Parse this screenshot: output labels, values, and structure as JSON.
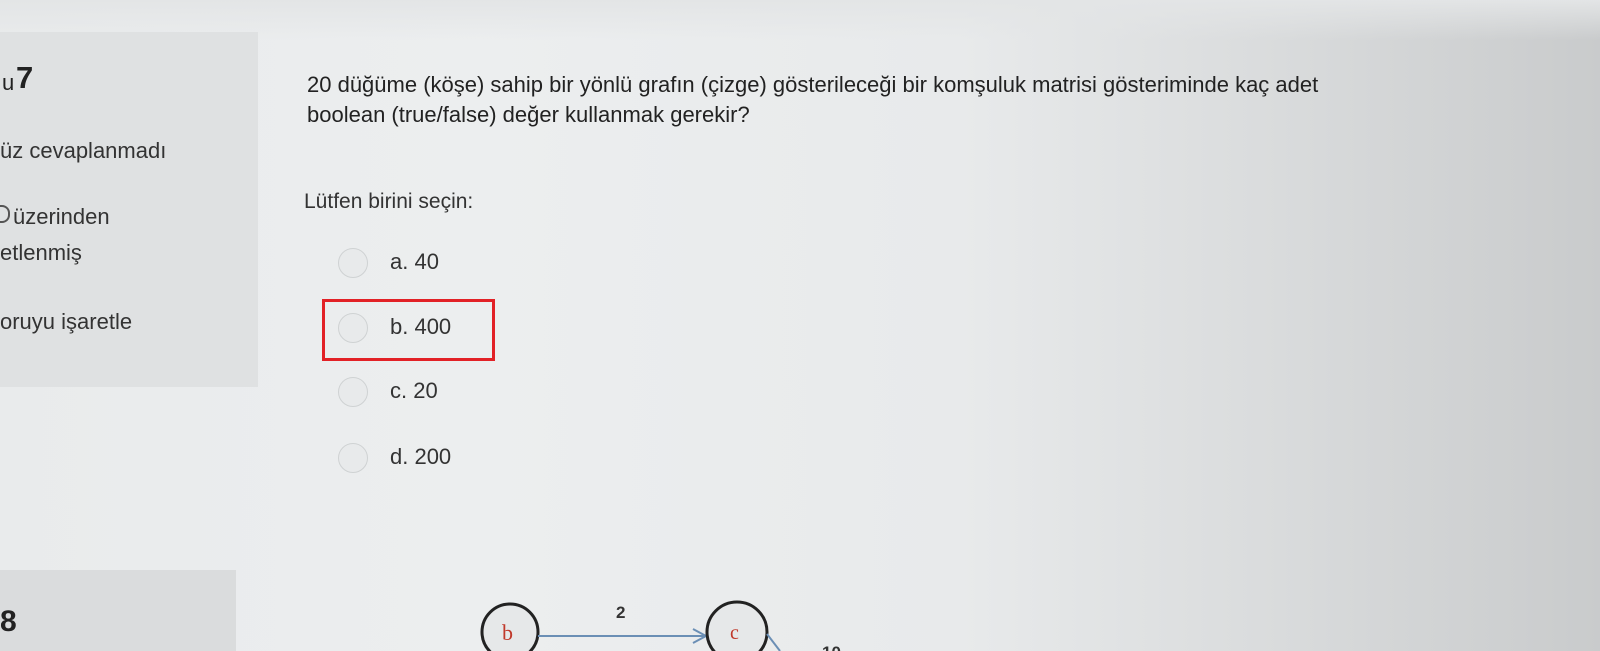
{
  "sidebar": {
    "question_prefix": "u",
    "question_number": "7",
    "status": "üz cevaplanmadı",
    "points_line1": "üzerinden",
    "points_line2": "etlenmiş",
    "flag_label": "oruyu işaretle",
    "next_question_number": "8"
  },
  "question": {
    "text_line1": "20 düğüme (köşe) sahip bir yönlü grafın (çizge) gösterileceği bir komşuluk matrisi gösteriminde kaç adet",
    "text_line2": "boolean (true/false) değer kullanmak gerekir?",
    "prompt": "Lütfen birini seçin:"
  },
  "options": [
    {
      "label": "a. 40"
    },
    {
      "label": "b. 400"
    },
    {
      "label": "c. 20"
    },
    {
      "label": "d. 200"
    }
  ],
  "highlight_color": "#e22126",
  "graph": {
    "node1": "b",
    "node2": "c",
    "edge_weight": "2",
    "partial_weight": "10"
  }
}
